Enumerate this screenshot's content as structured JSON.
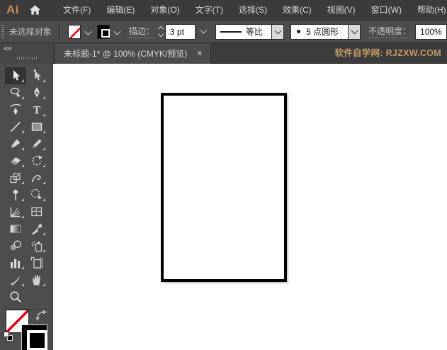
{
  "app": {
    "logo": "Ai",
    "window": "Adobe Illustrator"
  },
  "colors": {
    "logo_orange": "#ce8a55",
    "promo_gold": "#c29a63",
    "none_red": "#e3000f",
    "menubar_bg": "#3b3b3b",
    "controlbar_bg": "#4c4c4c",
    "toolbar_bg": "#4d4d4d",
    "canvas_bg": "#ffffff"
  },
  "menu_bar": {
    "items": [
      {
        "name": "file",
        "label": "文件(F)"
      },
      {
        "name": "edit",
        "label": "编辑(E)"
      },
      {
        "name": "object",
        "label": "对象(O)"
      },
      {
        "name": "type",
        "label": "文字(T)"
      },
      {
        "name": "select",
        "label": "选择(S)"
      },
      {
        "name": "effect",
        "label": "效果(C)"
      },
      {
        "name": "view",
        "label": "视图(V)"
      },
      {
        "name": "window",
        "label": "窗口(W)"
      },
      {
        "name": "help",
        "label": "帮助(H)"
      }
    ]
  },
  "control_bar": {
    "no_selection_label": "未选择对象",
    "stroke_label": "描边：",
    "stroke_value": "3 pt",
    "profile_value": "等比",
    "brush_value": "5 点圆形",
    "opacity_label": "不透明度：",
    "opacity_value": "100%"
  },
  "tab_bar": {
    "collapse_glyph": "««",
    "tab_title": "未标题-1* @ 100% (CMYK/预览)",
    "close_glyph": "×",
    "promo_text": "软件自学网: RJZXW.COM"
  },
  "toolbar": {
    "tools": [
      {
        "name": "selection-tool",
        "selected": true,
        "flyout": true
      },
      {
        "name": "direct-selection-tool",
        "selected": false,
        "flyout": true
      },
      {
        "name": "lasso-tool",
        "selected": false,
        "flyout": true
      },
      {
        "name": "pen-tool",
        "selected": false,
        "flyout": true
      },
      {
        "name": "curvature-tool",
        "selected": false,
        "flyout": false
      },
      {
        "name": "type-tool",
        "selected": false,
        "flyout": true
      },
      {
        "name": "line-segment-tool",
        "selected": false,
        "flyout": true
      },
      {
        "name": "rectangle-tool",
        "selected": false,
        "flyout": true
      },
      {
        "name": "paintbrush-tool",
        "selected": false,
        "flyout": true
      },
      {
        "name": "pencil-tool",
        "selected": false,
        "flyout": true
      },
      {
        "name": "eraser-tool",
        "selected": false,
        "flyout": true
      },
      {
        "name": "rotate-tool",
        "selected": false,
        "flyout": true
      },
      {
        "name": "scale-tool",
        "selected": false,
        "flyout": true
      },
      {
        "name": "width-tool",
        "selected": false,
        "flyout": true
      },
      {
        "name": "puppet-warp-tool",
        "selected": false,
        "flyout": true
      },
      {
        "name": "shape-builder-tool",
        "selected": false,
        "flyout": true
      },
      {
        "name": "perspective-grid-tool",
        "selected": false,
        "flyout": true
      },
      {
        "name": "mesh-tool",
        "selected": false,
        "flyout": false
      },
      {
        "name": "gradient-tool",
        "selected": false,
        "flyout": false
      },
      {
        "name": "eyedropper-tool",
        "selected": false,
        "flyout": true
      },
      {
        "name": "blend-tool",
        "selected": false,
        "flyout": false
      },
      {
        "name": "symbol-sprayer-tool",
        "selected": false,
        "flyout": true
      },
      {
        "name": "column-graph-tool",
        "selected": false,
        "flyout": true
      },
      {
        "name": "artboard-tool",
        "selected": false,
        "flyout": false
      },
      {
        "name": "knife-tool",
        "selected": false,
        "flyout": true
      },
      {
        "name": "hand-tool",
        "selected": false,
        "flyout": true
      },
      {
        "name": "zoom-tool",
        "selected": false,
        "flyout": false
      }
    ]
  },
  "canvas": {
    "artboard": "white rectangle with 3pt black stroke"
  }
}
